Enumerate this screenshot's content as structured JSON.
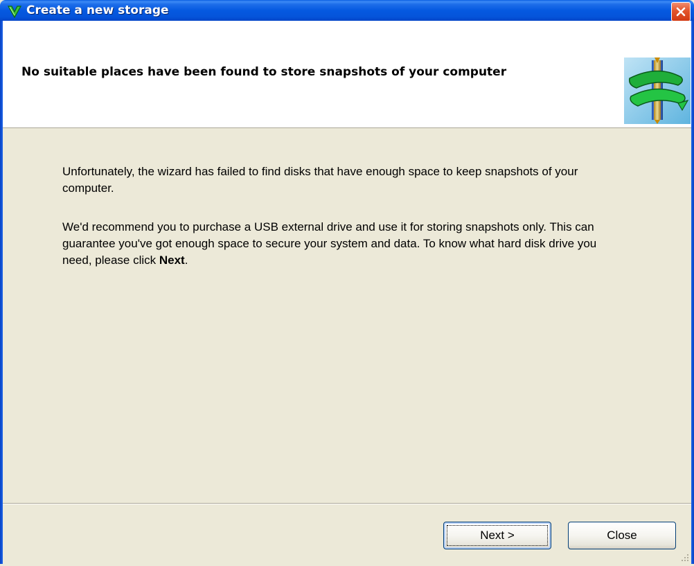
{
  "window": {
    "title": "Create a new storage",
    "close_icon": "close-icon",
    "app_icon": "green-check-shield-icon"
  },
  "header": {
    "title": "No suitable places have been found to store snapshots of your computer",
    "icon": "storage-spiral-icon"
  },
  "body": {
    "paragraph1": "Unfortunately, the wizard has failed to find disks that have enough space to keep snapshots of your computer.",
    "paragraph2_text": "We'd recommend you to purchase a USB external drive and use it for storing snapshots only. This can guarantee you've got enough space to secure your system and data. To know what hard disk drive you need, please click ",
    "paragraph2_bold": "Next",
    "paragraph2_end": "."
  },
  "buttons": {
    "next_label": "Next >",
    "close_label": "Close"
  },
  "colors": {
    "titlebar": "#0559E0",
    "background": "#ECE9D8",
    "close_button": "#D23A13"
  }
}
